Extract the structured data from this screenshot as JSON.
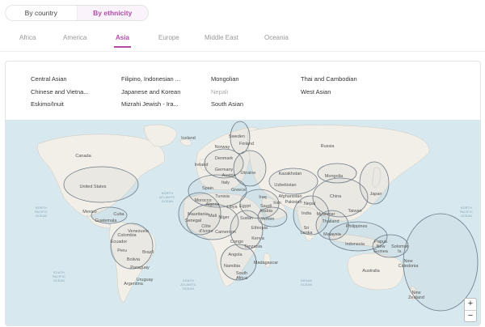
{
  "view_toggle": {
    "by_country": "By country",
    "by_ethnicity": "By ethnicity",
    "selected": "By ethnicity"
  },
  "tabs": [
    "Africa",
    "America",
    "Asia",
    "Europe",
    "Middle East",
    "Oceania"
  ],
  "active_tab": "Asia",
  "legend": [
    {
      "label": "Central Asian",
      "dim": false
    },
    {
      "label": "Chinese and Vietna...",
      "dim": false
    },
    {
      "label": "Eskimo/Inuit",
      "dim": false
    },
    {
      "label": "Filipino, Indonesian ...",
      "dim": false
    },
    {
      "label": "Japanese and Korean",
      "dim": false
    },
    {
      "label": "Mizrahi Jewish - Ira...",
      "dim": false
    },
    {
      "label": "Mongolian",
      "dim": false
    },
    {
      "label": "Nepali",
      "dim": true
    },
    {
      "label": "South Asian",
      "dim": false
    },
    {
      "label": "Thai and Cambodian",
      "dim": false
    },
    {
      "label": "West Asian",
      "dim": false
    }
  ],
  "map_labels": {
    "canada": "Canada",
    "united_states": "United States",
    "mexico": "Mexico",
    "cuba": "Cuba",
    "guatemala": "Guatemala",
    "venezuela": "Venezuela",
    "colombia": "Colombia",
    "ecuador": "Ecuador",
    "peru": "Peru",
    "brazil": "Brazil",
    "bolivia": "Bolivia",
    "paraguay": "Paraguay",
    "uruguay": "Uruguay",
    "argentina": "Argentina",
    "iceland": "Iceland",
    "sweden": "Sweden",
    "norway": "Norway",
    "finland": "Finland",
    "denmark": "Denmark",
    "ireland": "Ireland",
    "germany": "Germany",
    "austria": "Austria",
    "ukraine": "Ukraine",
    "italy": "Italy",
    "spain": "Spain",
    "greece": "Greece",
    "tunisia": "Tunisia",
    "morocco": "Morocco",
    "algeria": "Algeria",
    "libya": "Libya",
    "egypt": "Egypt",
    "mauritania": "Mauritania",
    "mali": "Mali",
    "niger": "Niger",
    "senegal": "Senegal",
    "sudan": "Sudan",
    "cote": "Côte",
    "divoire": "d'Ivoire",
    "cameroon": "Cameroon",
    "congo": "Congo",
    "kenya": "Kenya",
    "tanzania": "Tanzania",
    "angola": "Angola",
    "namibia": "Namibia",
    "south": "South",
    "africa": "Africa",
    "madagascar": "Madagascar",
    "ethiopia": "Ethiopia",
    "yemen": "Yemen",
    "saudi": "Saudi",
    "arabia": "Arabia",
    "iraq": "Iraq",
    "iran": "Iran",
    "russia": "Russia",
    "kazakhstan": "Kazakhstan",
    "uzbekistan": "Uzbekistan",
    "afghanistan": "Afghanistan",
    "pakistan": "Pakistan",
    "nepal": "Nepal",
    "india": "India",
    "sri": "Sri",
    "lanka": "Lanka",
    "mongolia": "Mongolia",
    "china": "China",
    "japan": "Japan",
    "taiwan": "Taiwan",
    "myanmar": "Myanmar",
    "thailand": "Thailand",
    "philippines": "Philippines",
    "malaysia": "Malaysia",
    "indonesia": "Indonesia",
    "papua": "Papua",
    "new": "New",
    "guinea": "Guinea",
    "solomon": "Solomon",
    "is": "Is.",
    "new_caledonia_1": "New",
    "new_caledonia_2": "Caledonia",
    "australia": "Australia",
    "new_zealand_1": "New",
    "new_zealand_2": "Zealand",
    "north": "NORTH",
    "atlantic": "ATLANTIC",
    "ocean": "OCEAN",
    "pacific": "PACIFIC",
    "indian": "INDIAN",
    "south_o": "SOUTH"
  },
  "colors": {
    "accent": "#b24aa8",
    "water": "#d7e8ee",
    "land": "#f2efe9",
    "region_stroke": "#6f7a86"
  },
  "zoom": {
    "in": "+",
    "out": "−"
  }
}
